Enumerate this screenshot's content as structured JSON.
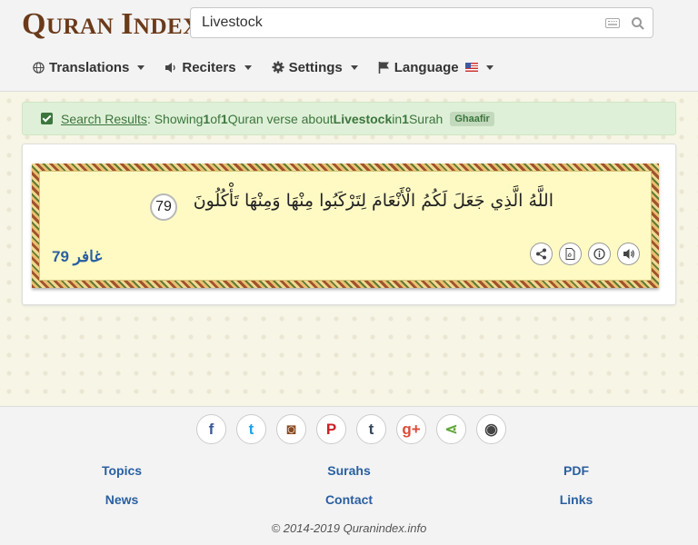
{
  "header": {
    "logo": {
      "q": "Q",
      "uran": "URAN",
      "i": "I",
      "ndex": "NDEX",
      "mark": "✗"
    },
    "search": {
      "value": "Livestock",
      "placeholder": ""
    },
    "nav": [
      {
        "label": "Translations",
        "icon": "globe-icon"
      },
      {
        "label": "Reciters",
        "icon": "speaker-icon"
      },
      {
        "label": "Settings",
        "icon": "gear-icon"
      },
      {
        "label": "Language",
        "icon": "flag-icon"
      }
    ]
  },
  "alert": {
    "link": "Search Results",
    "t1": ": Showing ",
    "n1": "1",
    "t2": " of ",
    "n2": "1",
    "t3": " Quran verse about ",
    "topic": "Livestock",
    "t4": " in ",
    "n3": "1",
    "t5": " Surah",
    "badge": "Ghaafir"
  },
  "verse": {
    "arabic": "اللَّهُ الَّذِي جَعَلَ لَكُمُ الْأَنْعَامَ لِتَرْكَبُوا مِنْهَا وَمِنْهَا تَأْكُلُونَ",
    "number": "79",
    "reference": "غافر 79",
    "actions": [
      "share-icon",
      "pdf-icon",
      "info-icon",
      "audio-icon"
    ]
  },
  "footer": {
    "social": [
      {
        "icon": "facebook-icon",
        "glyph": "f",
        "color": "#3b5998"
      },
      {
        "icon": "twitter-icon",
        "glyph": "t",
        "color": "#1da1f2"
      },
      {
        "icon": "instagram-icon",
        "glyph": "◙",
        "color": "#8a4a1f"
      },
      {
        "icon": "pinterest-icon",
        "glyph": "P",
        "color": "#cb2027"
      },
      {
        "icon": "tumblr-icon",
        "glyph": "t",
        "color": "#35465c"
      },
      {
        "icon": "googleplus-icon",
        "glyph": "g+",
        "color": "#dd4b39"
      },
      {
        "icon": "share-icon",
        "glyph": "⋖",
        "color": "#5fa83a"
      },
      {
        "icon": "github-icon",
        "glyph": "◉",
        "color": "#444"
      }
    ],
    "links": [
      {
        "label": "Topics"
      },
      {
        "label": "Surahs"
      },
      {
        "label": "PDF"
      },
      {
        "label": "News"
      },
      {
        "label": "Contact"
      },
      {
        "label": "Links"
      }
    ],
    "copyright": "© 2014-2019 Quranindex.info"
  }
}
